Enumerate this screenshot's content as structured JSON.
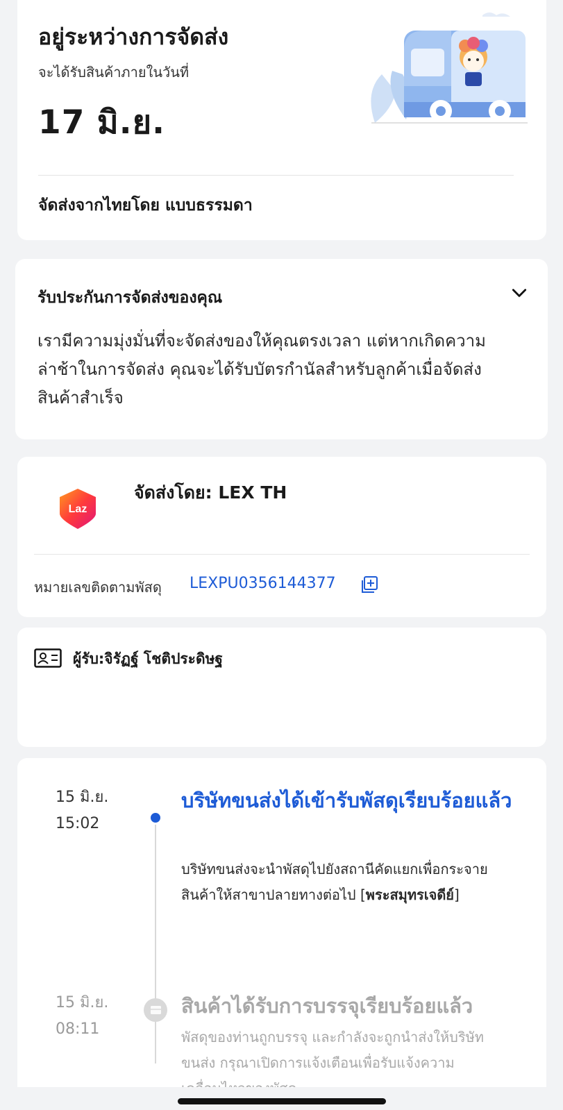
{
  "status": {
    "title": "อยู่ระหว่างการจัดส่ง",
    "subtitle": "จะได้รับสินค้าภายในวันที่",
    "date": "17 มิ.ย.",
    "method": "จัดส่งจากไทยโดย แบบธรรมดา",
    "illustration": "delivery-truck-illustration"
  },
  "guarantee": {
    "title": "รับประกันการจัดส่งของคุณ",
    "body": "เรามีความมุ่งมั่นที่จะจัดส่งของให้คุณตรงเวลา แต่หากเกิดความล่าช้าในการจัดส่ง คุณจะได้รับบัตรกำนัลสำหรับลูกค้าเมื่อจัดส่งสินค้าสำเร็จ",
    "icon": "chevron-down-icon"
  },
  "carrier": {
    "label": "จัดส่งโดย: LEX TH",
    "logo_text": "Laz",
    "tracking_label": "หมายเลขติดตามพัสดุ",
    "tracking_number": "LEXPU0356144377",
    "copy_icon": "copy-icon"
  },
  "recipient": {
    "label": "ผู้รับ:จิรัฏฐ์  โชติประดิษฐ",
    "icon": "id-card-icon"
  },
  "timeline": [
    {
      "date": "15 มิ.ย.",
      "time": "15:02",
      "title": "บริษัทขนส่งได้เข้ารับพัสดุเรียบร้อยแล้ว",
      "desc": "บริษัทขนส่งจะนำพัสดุไปยังสถานีคัดแยกเพื่อกระจายสินค้าให้สาขาปลายทางต่อไป [",
      "desc_bold": "พระสมุทรเจดีย์",
      "desc_end": "]"
    },
    {
      "date": "15 มิ.ย.",
      "time": "08:11",
      "title": "สินค้าได้รับการบรรจุเรียบร้อยแล้ว",
      "desc": "พัสดุของท่านถูกบรรจุ และกำลังจะถูกนำส่งให้บริษัทขนส่ง กรุณาเปิดการแจ้งเตือนเพื่อรับแจ้งความเคลื่อนไหวของพัสดุ"
    }
  ],
  "colors": {
    "accent": "#1d5bd6",
    "background": "#f2f3f5",
    "muted": "#a8a8a8"
  }
}
